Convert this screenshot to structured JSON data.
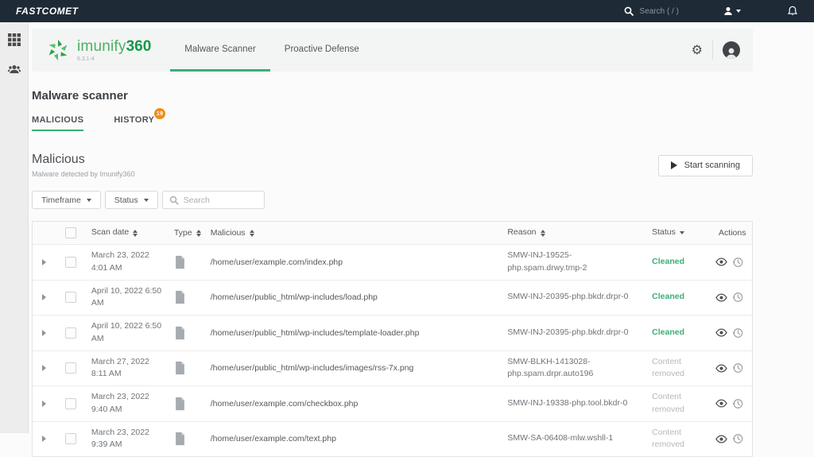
{
  "topbar": {
    "logo": "FASTCOMET",
    "search_label": "Search ( / )"
  },
  "app_header": {
    "brand": "imunify",
    "brand_suffix": "360",
    "version": "6.3.1-4",
    "tabs": [
      {
        "label": "Malware Scanner",
        "active": true
      },
      {
        "label": "Proactive Defense",
        "active": false
      }
    ]
  },
  "page": {
    "title": "Malware scanner",
    "tabs": [
      {
        "label": "MALICIOUS",
        "active": true
      },
      {
        "label": "HISTORY",
        "badge": "19",
        "active": false
      }
    ]
  },
  "section": {
    "title": "Malicious",
    "subtitle": "Malware detected by Imunify360",
    "scan_button": "Start scanning"
  },
  "filters": {
    "timeframe_label": "Timeframe",
    "status_label": "Status",
    "search_placeholder": "Search"
  },
  "table": {
    "columns": {
      "scan_date": "Scan date",
      "type": "Type",
      "malicious": "Malicious",
      "reason": "Reason",
      "status": "Status",
      "actions": "Actions"
    },
    "rows": [
      {
        "date": "March 23, 2022 4:01 AM",
        "file": "/home/user/example.com/index.php",
        "reason": "SMW-INJ-19525-php.spam.drwy.tmp-2",
        "status": "Cleaned"
      },
      {
        "date": "April 10, 2022 6:50 AM",
        "file": "/home/user/public_html/wp-includes/load.php",
        "reason": "SMW-INJ-20395-php.bkdr.drpr-0",
        "status": "Cleaned"
      },
      {
        "date": "April 10, 2022 6:50 AM",
        "file": "/home/user/public_html/wp-includes/template-loader.php",
        "reason": "SMW-INJ-20395-php.bkdr.drpr-0",
        "status": "Cleaned"
      },
      {
        "date": "March 27, 2022 8:11 AM",
        "file": "/home/user/public_html/wp-includes/images/rss-7x.png",
        "reason": "SMW-BLKH-1413028-php.spam.drpr.auto196",
        "status": "Content removed"
      },
      {
        "date": "March 23, 2022 9:40 AM",
        "file": "/home/user/example.com/checkbox.php",
        "reason": "SMW-INJ-19338-php.tool.bkdr-0",
        "status": "Content removed"
      },
      {
        "date": "March 23, 2022 9:39 AM",
        "file": "/home/user/example.com/text.php",
        "reason": "SMW-SA-06408-mlw.wshll-1",
        "status": "Content removed"
      }
    ]
  },
  "colors": {
    "topbar_bg": "#1e2b37",
    "accent_green": "#3cae73",
    "brand_green_light": "#4db05f",
    "brand_green_dark": "#17974c",
    "badge_orange": "#ef8e1b",
    "status_removed_gray": "#b4b8bc"
  }
}
